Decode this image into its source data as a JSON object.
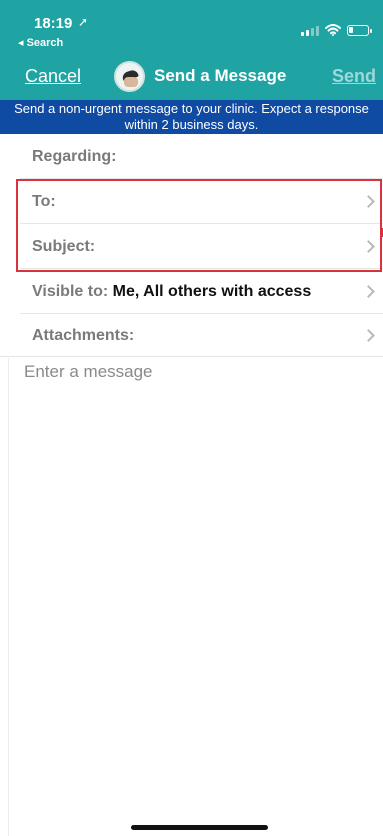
{
  "status_bar": {
    "time": "18:19",
    "location_glyph": "➚",
    "back_label": "◂ Search",
    "icons": [
      "signal-icon",
      "wifi-icon",
      "battery-icon"
    ]
  },
  "nav": {
    "cancel_label": "Cancel",
    "title": "Send a Message",
    "send_label": "Send"
  },
  "banner": {
    "text": "Send a non-urgent message to your clinic. Expect a response within 2 business days."
  },
  "form": {
    "regarding_label": "Regarding:",
    "to_label": "To:",
    "subject_label": "Subject:",
    "visible_to_label": "Visible to:",
    "visible_to_value": "Me, All others with access",
    "attachments_label": "Attachments:"
  },
  "message": {
    "placeholder": "Enter a message"
  },
  "colors": {
    "header_teal": "#1fa3a3",
    "banner_blue": "#0f4aa3",
    "highlight_red": "#d8333a"
  }
}
